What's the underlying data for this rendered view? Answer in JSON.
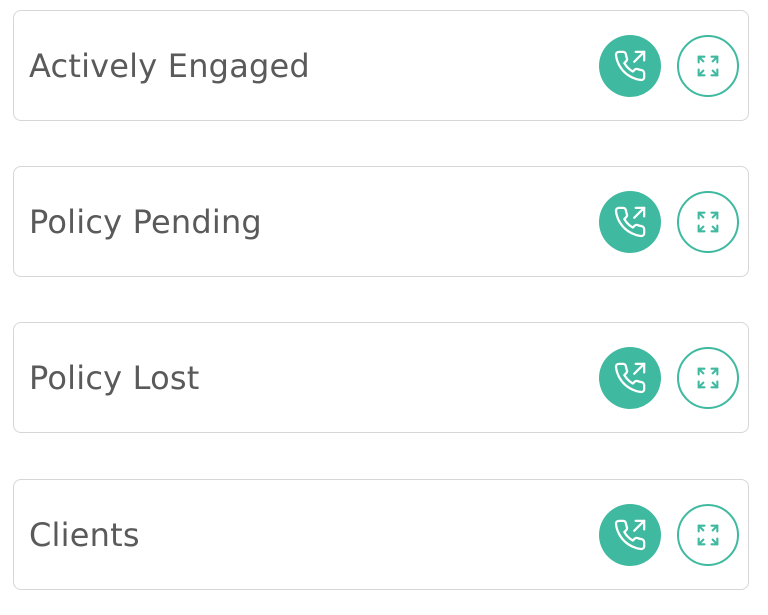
{
  "accent_color": "#3fb99f",
  "cards": [
    {
      "label": "Actively Engaged",
      "call_icon": "phone-outgoing-icon",
      "expand_icon": "expand-arrows-icon"
    },
    {
      "label": "Policy Pending",
      "call_icon": "phone-outgoing-icon",
      "expand_icon": "expand-arrows-icon"
    },
    {
      "label": "Policy Lost",
      "call_icon": "phone-outgoing-icon",
      "expand_icon": "expand-arrows-icon"
    },
    {
      "label": "Clients",
      "call_icon": "phone-outgoing-icon",
      "expand_icon": "expand-arrows-icon"
    }
  ]
}
